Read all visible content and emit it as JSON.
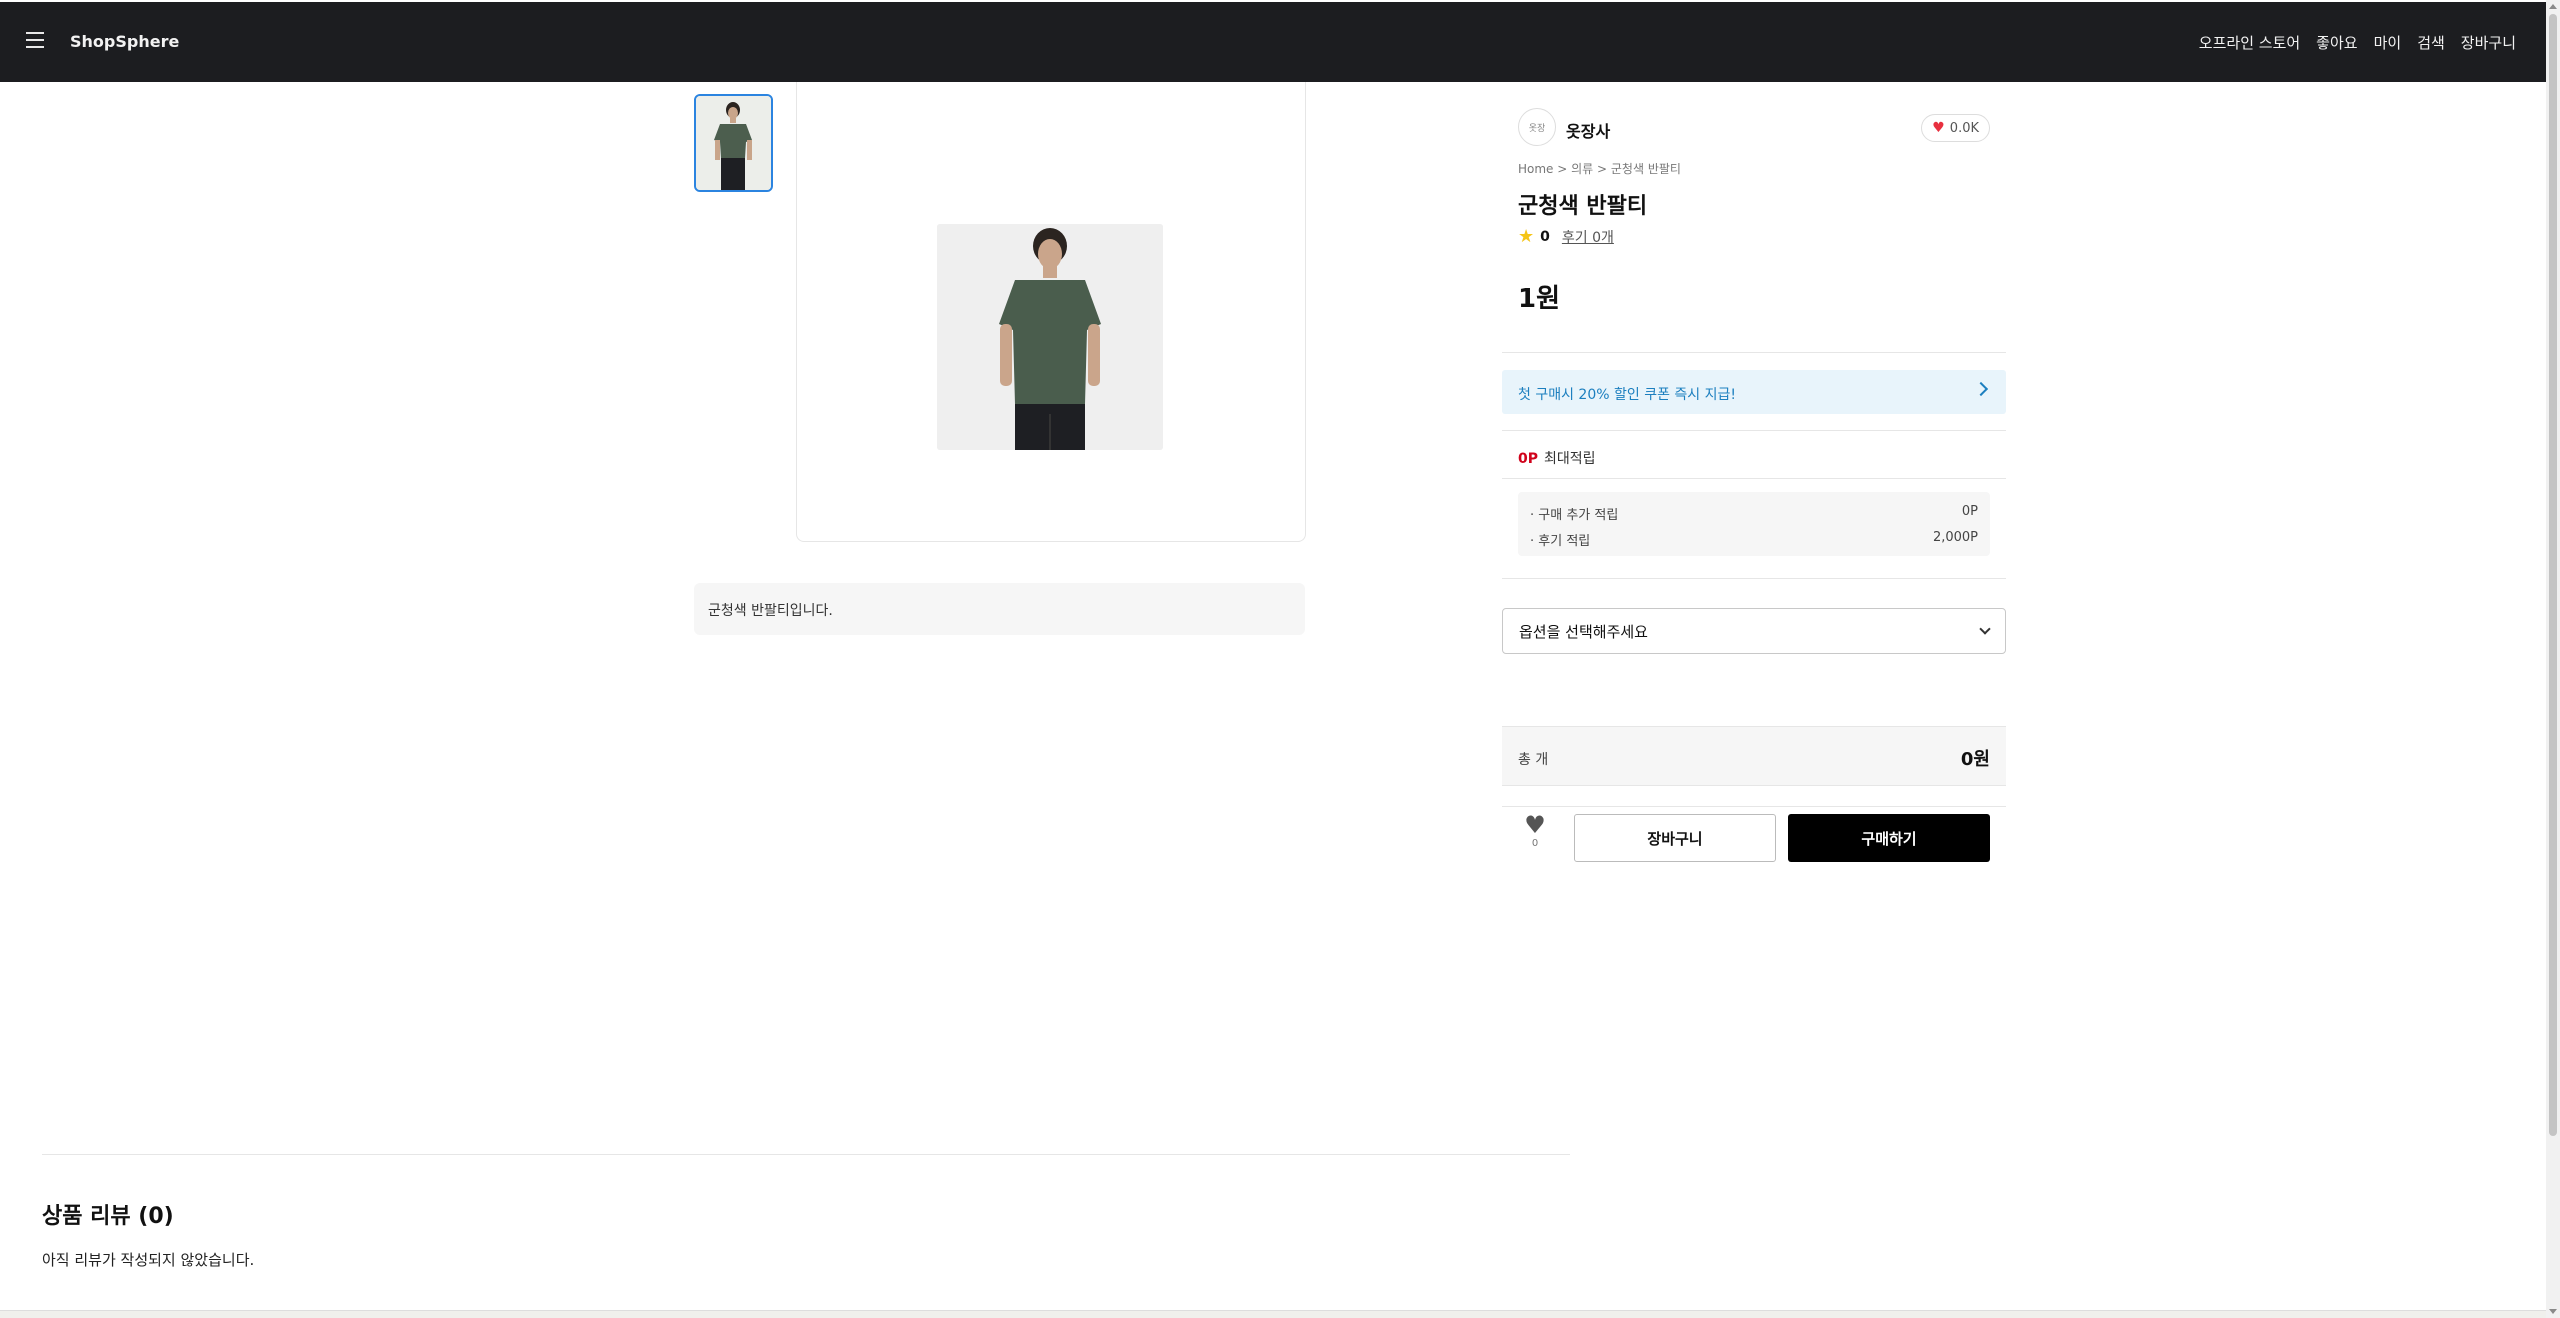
{
  "nav": {
    "brand": "ShopSphere",
    "links": [
      "오프라인 스토어",
      "좋아요",
      "마이",
      "검색",
      "장바구니"
    ]
  },
  "product": {
    "seller_logo": "옷장",
    "seller": "옷장사",
    "likes": "0.0K",
    "breadcrumb": "Home > 의류 > 군청색 반팔티",
    "title": "군청색 반팔티",
    "rating": "0",
    "review_link": "후기 0개",
    "price": "1원",
    "description": "군청색 반팔티입니다."
  },
  "coupon": {
    "text": "첫 구매시 20% 할인 쿠폰 즉시 지급!"
  },
  "points": {
    "max_value": "0P",
    "max_label": "최대적립",
    "rows": [
      {
        "label": "· 구매 추가 적립",
        "value": "0P"
      },
      {
        "label": "· 후기 적립",
        "value": "2,000P"
      }
    ]
  },
  "option": {
    "placeholder": "옵션을 선택해주세요"
  },
  "total": {
    "label": "총 개",
    "value": "0원"
  },
  "actions": {
    "wish_count": "0",
    "cart_label": "장바구니",
    "buy_label": "구매하기"
  },
  "reviews": {
    "title": "상품 리뷰 (0)",
    "empty": "아직 리뷰가 작성되지 않았습니다."
  },
  "colors": {
    "topbar": "#1c1d20",
    "accent_blue": "#2b84e0",
    "coupon_bg": "#e8f4fb",
    "points_red": "#d0021b",
    "buy_button": "#000000"
  }
}
